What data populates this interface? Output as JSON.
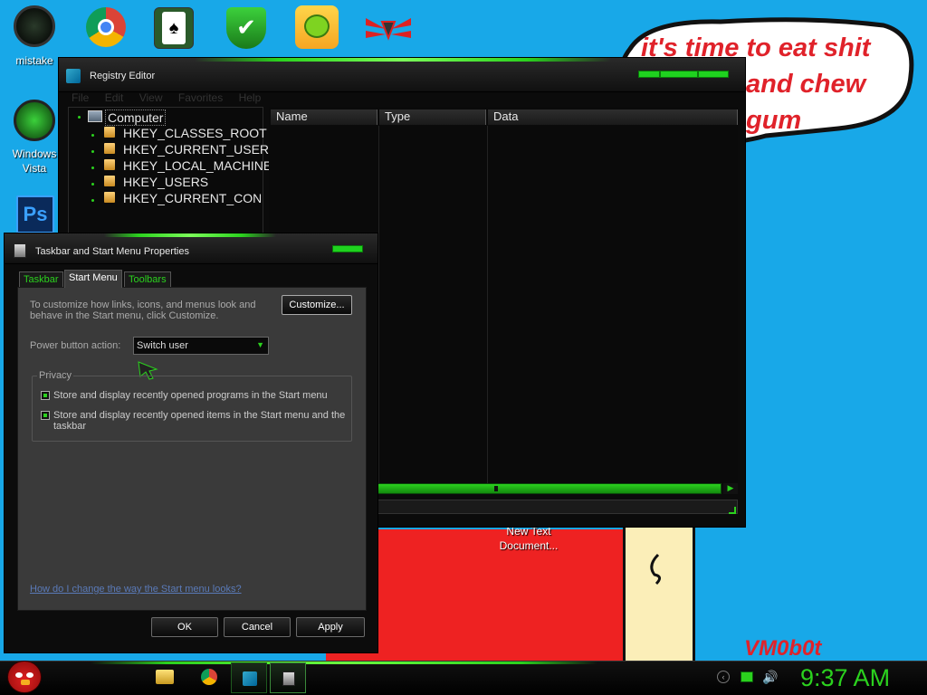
{
  "desktop": {
    "icons": [
      {
        "label": "mistake",
        "icon": "mistake-icon"
      },
      {
        "label": "Windows Vista",
        "icon": "recycle-bin-icon"
      },
      {
        "label": "",
        "icon": "photoshop-icon",
        "glyph": "Ps"
      }
    ],
    "top_icons": [
      "chrome-icon",
      "solitaire-icon",
      "security-shield-icon",
      "bad-piggies-icon",
      "winged-logo-icon"
    ],
    "cloud_text": [
      "it's time to eat shit",
      "and chew",
      "gum"
    ],
    "file_label": "New Text Document...",
    "signature": "VM0b0t"
  },
  "registry": {
    "title": "Registry Editor",
    "menu": [
      "File",
      "Edit",
      "View",
      "Favorites",
      "Help"
    ],
    "root": "Computer",
    "keys": [
      "HKEY_CLASSES_ROOT",
      "HKEY_CURRENT_USER",
      "HKEY_LOCAL_MACHINE",
      "HKEY_USERS",
      "HKEY_CURRENT_CONFI"
    ],
    "columns": [
      "Name",
      "Type",
      "Data"
    ]
  },
  "dialog": {
    "title": "Taskbar and Start Menu Properties",
    "tabs": [
      "Taskbar",
      "Start Menu",
      "Toolbars"
    ],
    "active_tab": "Start Menu",
    "description": "To customize how links, icons, and menus look and behave in the Start menu, click Customize.",
    "customize_label": "Customize...",
    "power_label": "Power button action:",
    "power_value": "Switch user",
    "privacy_label": "Privacy",
    "checkbox1": "Store and display recently opened programs in the Start menu",
    "checkbox2": "Store and display recently opened items in the Start menu and the taskbar",
    "help_link": "How do I change the way the Start menu looks?",
    "ok": "OK",
    "cancel": "Cancel",
    "apply": "Apply"
  },
  "taskbar": {
    "clock": "9:37 AM",
    "pinned": [
      "explorer-icon",
      "chrome-icon",
      "registry-icon",
      "taskbar-properties-icon"
    ],
    "tray": [
      "arrow-icon",
      "network-icon",
      "volume-icon"
    ]
  },
  "colors": {
    "accent": "#2bd11e",
    "desktop": "#18a8e8",
    "cloud_text": "#e0222a"
  }
}
